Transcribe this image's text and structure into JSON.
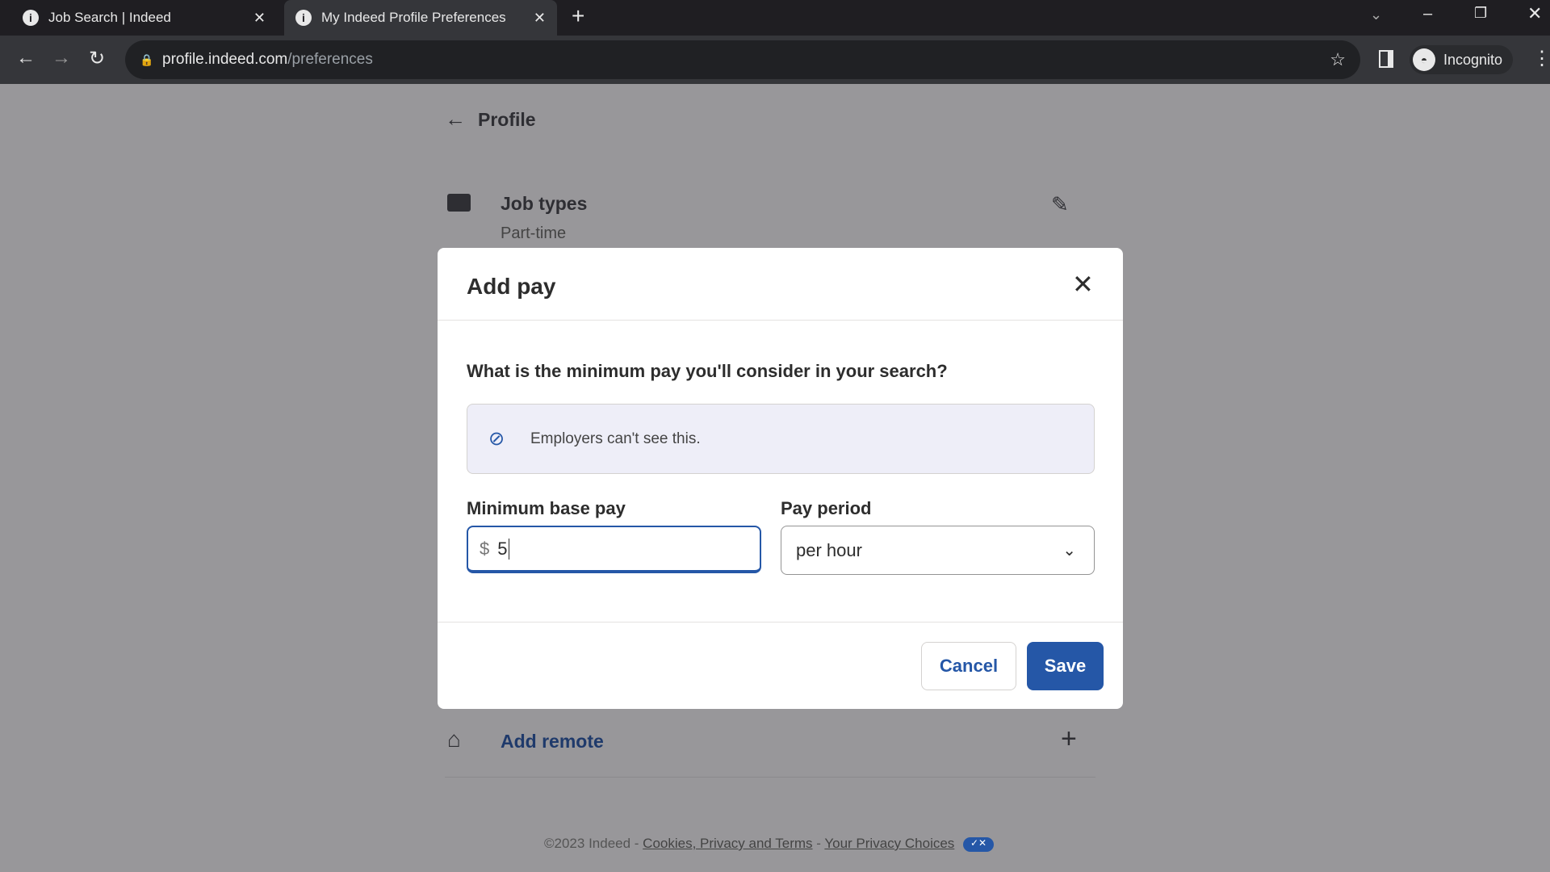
{
  "browser": {
    "tabs": [
      {
        "title": "Job Search | Indeed",
        "active": false
      },
      {
        "title": "My Indeed Profile Preferences",
        "active": true
      }
    ],
    "url_host": "profile.indeed.com",
    "url_path": "/preferences",
    "profile": "Incognito"
  },
  "page": {
    "back_label": "Profile",
    "job_types": {
      "title": "Job types",
      "value": "Part-time"
    },
    "add_remote": "Add remote",
    "footer": {
      "copyright": "©2023 Indeed - ",
      "link1": "Cookies, Privacy and Terms",
      "sep": " - ",
      "link2": "Your Privacy Choices"
    }
  },
  "modal": {
    "title": "Add pay",
    "question": "What is the minimum pay you'll consider in your search?",
    "notice": "Employers can't see this.",
    "min_pay_label": "Minimum base pay",
    "currency": "$",
    "min_pay_value": "5",
    "period_label": "Pay period",
    "period_value": "per hour",
    "cancel": "Cancel",
    "save": "Save"
  },
  "colors": {
    "accent": "#2557a7",
    "overlay": "#98979a"
  }
}
